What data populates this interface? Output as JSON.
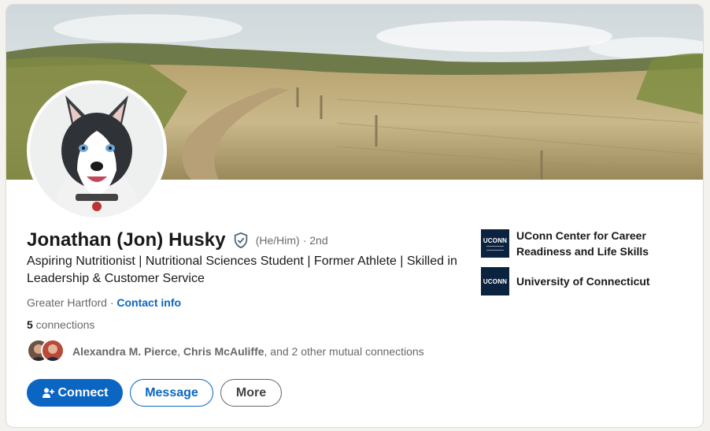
{
  "profile": {
    "name": "Jonathan (Jon) Husky",
    "pronouns": "(He/Him)",
    "degree": "· 2nd",
    "headline": "Aspiring Nutritionist | Nutritional Sciences Student | Former Athlete | Skilled in Leadership & Customer Service",
    "location": "Greater Hartford",
    "location_separator": " · ",
    "contact_info_label": "Contact info",
    "connections_count": "5",
    "connections_label": " connections"
  },
  "mutual": {
    "first": "Alexandra M. Pierce",
    "separator": ", ",
    "second": "Chris McAuliffe",
    "rest": ", and 2 other mutual connections"
  },
  "actions": {
    "connect_label": "Connect",
    "message_label": "Message",
    "more_label": "More"
  },
  "organizations": [
    {
      "logo_text": "UCONN",
      "name": "UConn Center for Career Readiness and Life Skills"
    },
    {
      "logo_text": "UCONN",
      "name": "University of Connecticut"
    }
  ],
  "icons": {
    "verified": "shield-check-icon",
    "connect": "person-add-icon"
  },
  "colors": {
    "primary": "#0a66c2",
    "logo_bg": "#0c2340"
  }
}
